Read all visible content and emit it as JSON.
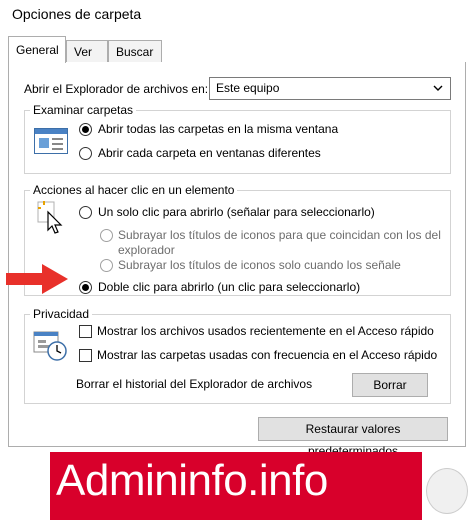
{
  "window": {
    "title": "Opciones de carpeta"
  },
  "tabs": [
    {
      "label": "General",
      "active": true
    },
    {
      "label": "Ver",
      "active": false
    },
    {
      "label": "Buscar",
      "active": false
    }
  ],
  "open_explorer": {
    "label": "Abrir el Explorador de archivos en:",
    "value": "Este equipo"
  },
  "browse": {
    "legend": "Examinar carpetas",
    "options": [
      {
        "label": "Abrir todas las carpetas en la misma ventana",
        "selected": true
      },
      {
        "label": "Abrir cada carpeta en ventanas diferentes",
        "selected": false
      }
    ]
  },
  "click": {
    "legend": "Acciones al hacer clic en un elemento",
    "single": "Un solo clic para abrirlo (señalar para seleccionarlo)",
    "sub1_line1": "Subrayar los títulos de iconos para que coincidan con los del",
    "sub1_line2": "explorador",
    "sub2": "Subrayar los títulos de iconos solo cuando los señale",
    "double": "Doble clic para abrirlo (un clic para seleccionarlo)"
  },
  "privacy": {
    "legend": "Privacidad",
    "recent_files": "Mostrar los archivos usados recientemente en el Acceso rápido",
    "frequent_folders": "Mostrar las carpetas usadas con frecuencia en el Acceso rápido",
    "clear_label": "Borrar el historial del Explorador de archivos",
    "clear_button": "Borrar"
  },
  "restore_button": "Restaurar valores predeterminados",
  "watermark": "Admininfo.info",
  "colors": {
    "banner": "#d8002b",
    "arrow": "#e8302a",
    "accent": "#1a6fd1"
  }
}
